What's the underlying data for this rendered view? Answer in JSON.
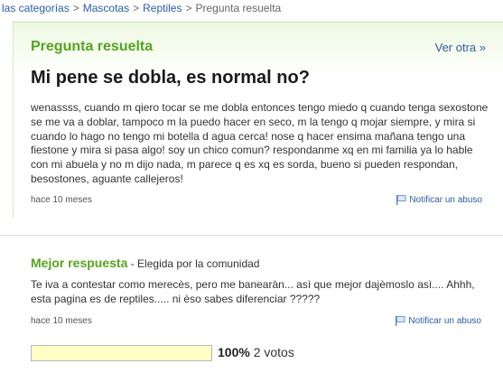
{
  "breadcrumb": {
    "items": [
      "las categorías",
      "Mascotas",
      "Reptiles",
      "Pregunta resuelta"
    ],
    "separator": ">"
  },
  "question": {
    "status": "Pregunta resuelta",
    "see_other": "Ver otra »",
    "title": "Mi pene se dobla, es normal no?",
    "body": "wenassss, cuando m qiero tocar se me dobla entonces tengo miedo q cuando tenga sexostone se me va a doblar, tampoco m la puedo hacer en seco, m la tengo q mojar siempre, y mira si cuando lo hago no tengo mi botella d agua cerca! nose q hacer ensima mañana tengo una fiestone y mira si pasa algo! soy un chico comun? respondanme xq en mi familia ya lo hable con mi abuela y no m dijo nada, m parece q es xq es sorda, bueno si pueden respondan, besostones, aguante callejeros!",
    "time": "hace 10 meses",
    "report": "Notificar un abuso"
  },
  "best_answer": {
    "label": "Mejor respuesta",
    "dash": " - ",
    "chosen_by": "Elegida por la comunidad",
    "body": "Te iva a contestar como merecès, pero me banearàn... asì que mejor dajèmoslo asì.... Ahhh, esta pagina es de reptiles..... ni èso sabes diferenciar ?????",
    "time": "hace 10 meses",
    "report": "Notificar un abuso",
    "vote_percent_label": "100%",
    "vote_fraction": 1.0,
    "votes": "2 votos"
  },
  "colors": {
    "accent_green": "#55a51c",
    "link_blue": "#2a5da8",
    "vote_fill": "#ffffc6"
  }
}
